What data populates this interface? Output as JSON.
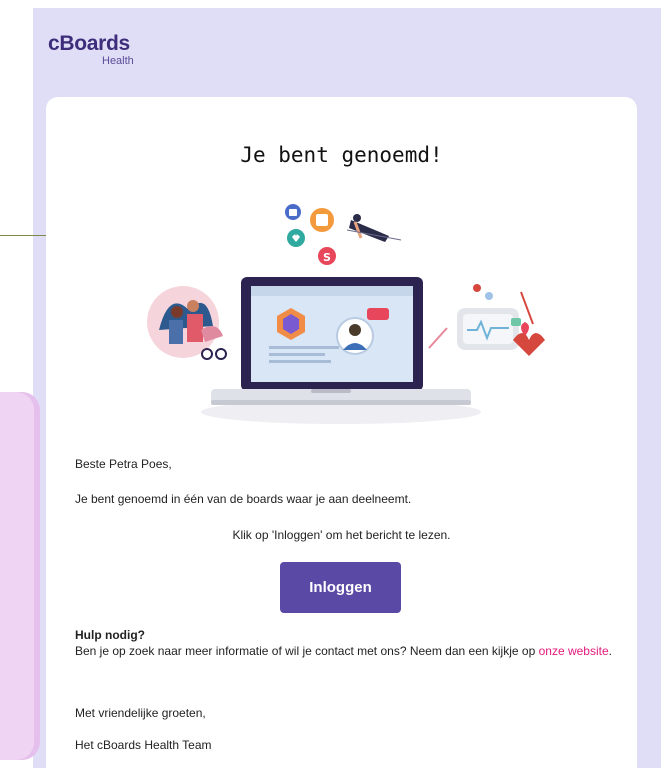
{
  "brand": {
    "name": "cBoards",
    "sub": "Health"
  },
  "email": {
    "headline": "Je bent genoemd!",
    "greeting": "Beste Petra Poes,",
    "body_line": "Je bent genoemd in één van de boards waar je aan deelneemt.",
    "instruction": "Klik op 'Inloggen' om het bericht te lezen.",
    "button_label": "Inloggen",
    "help_heading": "Hulp nodig?",
    "help_text": "Ben je op zoek naar meer informatie of wil je contact met ons? Neem dan een kijkje op",
    "help_link": "onze website",
    "help_link_suffix": ".",
    "closing": "Met vriendelijke groeten,",
    "signature": "Het cBoards Health Team"
  },
  "colors": {
    "background": "#e0def6",
    "accent": "#5b4aa5",
    "link": "#e4197b",
    "brand": "#3d2d7a"
  }
}
